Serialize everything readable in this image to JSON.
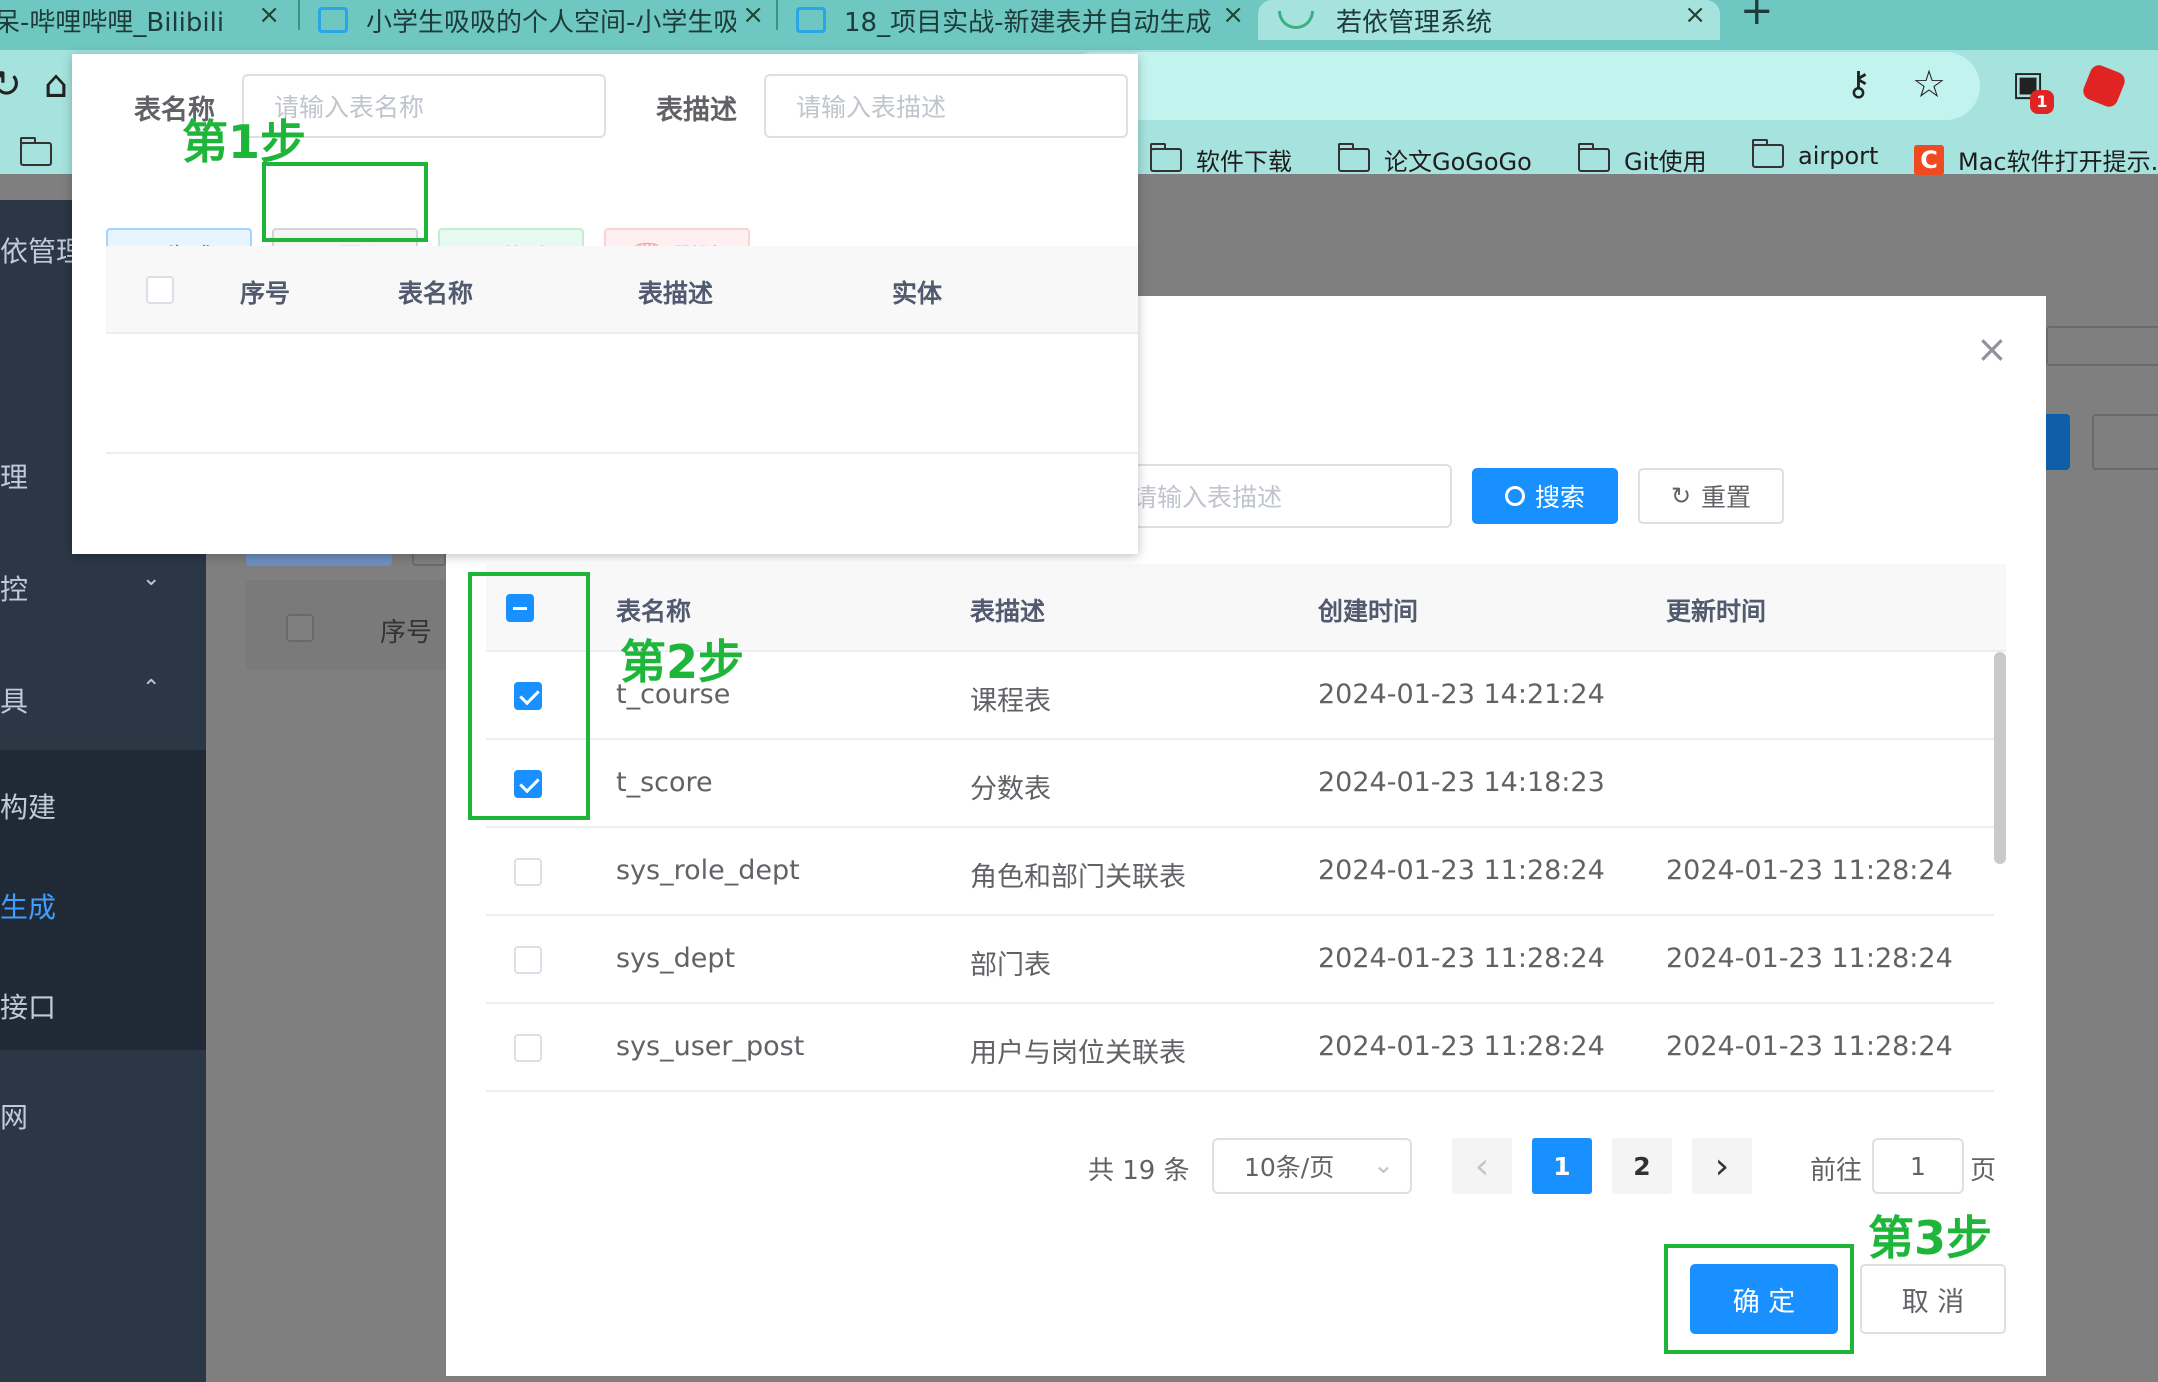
{
  "browser": {
    "tabs": [
      {
        "title": "呆-哔哩哔哩_Bilibili",
        "close": "×"
      },
      {
        "title": "小学生吸吸的个人空间-小学生吸",
        "close": "×"
      },
      {
        "title": "18_项目实战-新建表并自动生成",
        "close": "×"
      },
      {
        "title": "若依管理系统",
        "close": "×"
      }
    ],
    "new_tab": "+",
    "extension_badge": "1",
    "bookmarks": [
      {
        "label": "软件下载"
      },
      {
        "label": "论文GoGoGo"
      },
      {
        "label": "Git使用"
      },
      {
        "label": "airport"
      },
      {
        "label": "Mac软件打开提示..."
      }
    ],
    "bookmark_c_icon": "C"
  },
  "sidebar": {
    "items": [
      "依管理",
      "理",
      "控",
      "具",
      "构建",
      "生成",
      "接口",
      "网"
    ],
    "active": "生成"
  },
  "background_page": {
    "col_index": "序号"
  },
  "popup": {
    "label_table_name": "表名称",
    "placeholder_table_name": "请输入表名称",
    "label_table_desc": "表描述",
    "placeholder_table_desc": "请输入表描述",
    "buttons": {
      "generate": "生成",
      "import": "导入",
      "edit": "修改",
      "delete": "删除"
    },
    "columns": [
      "序号",
      "表名称",
      "表描述",
      "实体"
    ]
  },
  "dialog": {
    "close": "×",
    "search_placeholder_desc": "请输入表描述",
    "search_button": "搜索",
    "reset_button": "重置",
    "columns": [
      "表名称",
      "表描述",
      "创建时间",
      "更新时间"
    ],
    "rows": [
      {
        "name": "t_course",
        "desc": "课程表",
        "created": "2024-01-23 14:21:24",
        "updated": "",
        "checked": true
      },
      {
        "name": "t_score",
        "desc": "分数表",
        "created": "2024-01-23 14:18:23",
        "updated": "",
        "checked": true
      },
      {
        "name": "sys_role_dept",
        "desc": "角色和部门关联表",
        "created": "2024-01-23 11:28:24",
        "updated": "2024-01-23 11:28:24",
        "checked": false
      },
      {
        "name": "sys_dept",
        "desc": "部门表",
        "created": "2024-01-23 11:28:24",
        "updated": "2024-01-23 11:28:24",
        "checked": false
      },
      {
        "name": "sys_user_post",
        "desc": "用户与岗位关联表",
        "created": "2024-01-23 11:28:24",
        "updated": "2024-01-23 11:28:24",
        "checked": false
      }
    ],
    "pagination": {
      "total": "共 19 条",
      "page_size": "10条/页",
      "prev": "‹",
      "pages": [
        "1",
        "2"
      ],
      "current": "1",
      "next": "›",
      "goto_label": "前往",
      "goto_value": "1",
      "goto_suffix": "页"
    },
    "confirm": "确 定",
    "cancel": "取 消"
  },
  "annotations": {
    "step1": "第1步",
    "step2": "第2步",
    "step3": "第3步",
    "color": "#1fb53a"
  },
  "colors": {
    "primary": "#1890ff",
    "sidebar_bg": "#2b3745",
    "browser_tab_bg": "#6fc7c1",
    "browser_toolbar_bg": "#a6e3de"
  }
}
